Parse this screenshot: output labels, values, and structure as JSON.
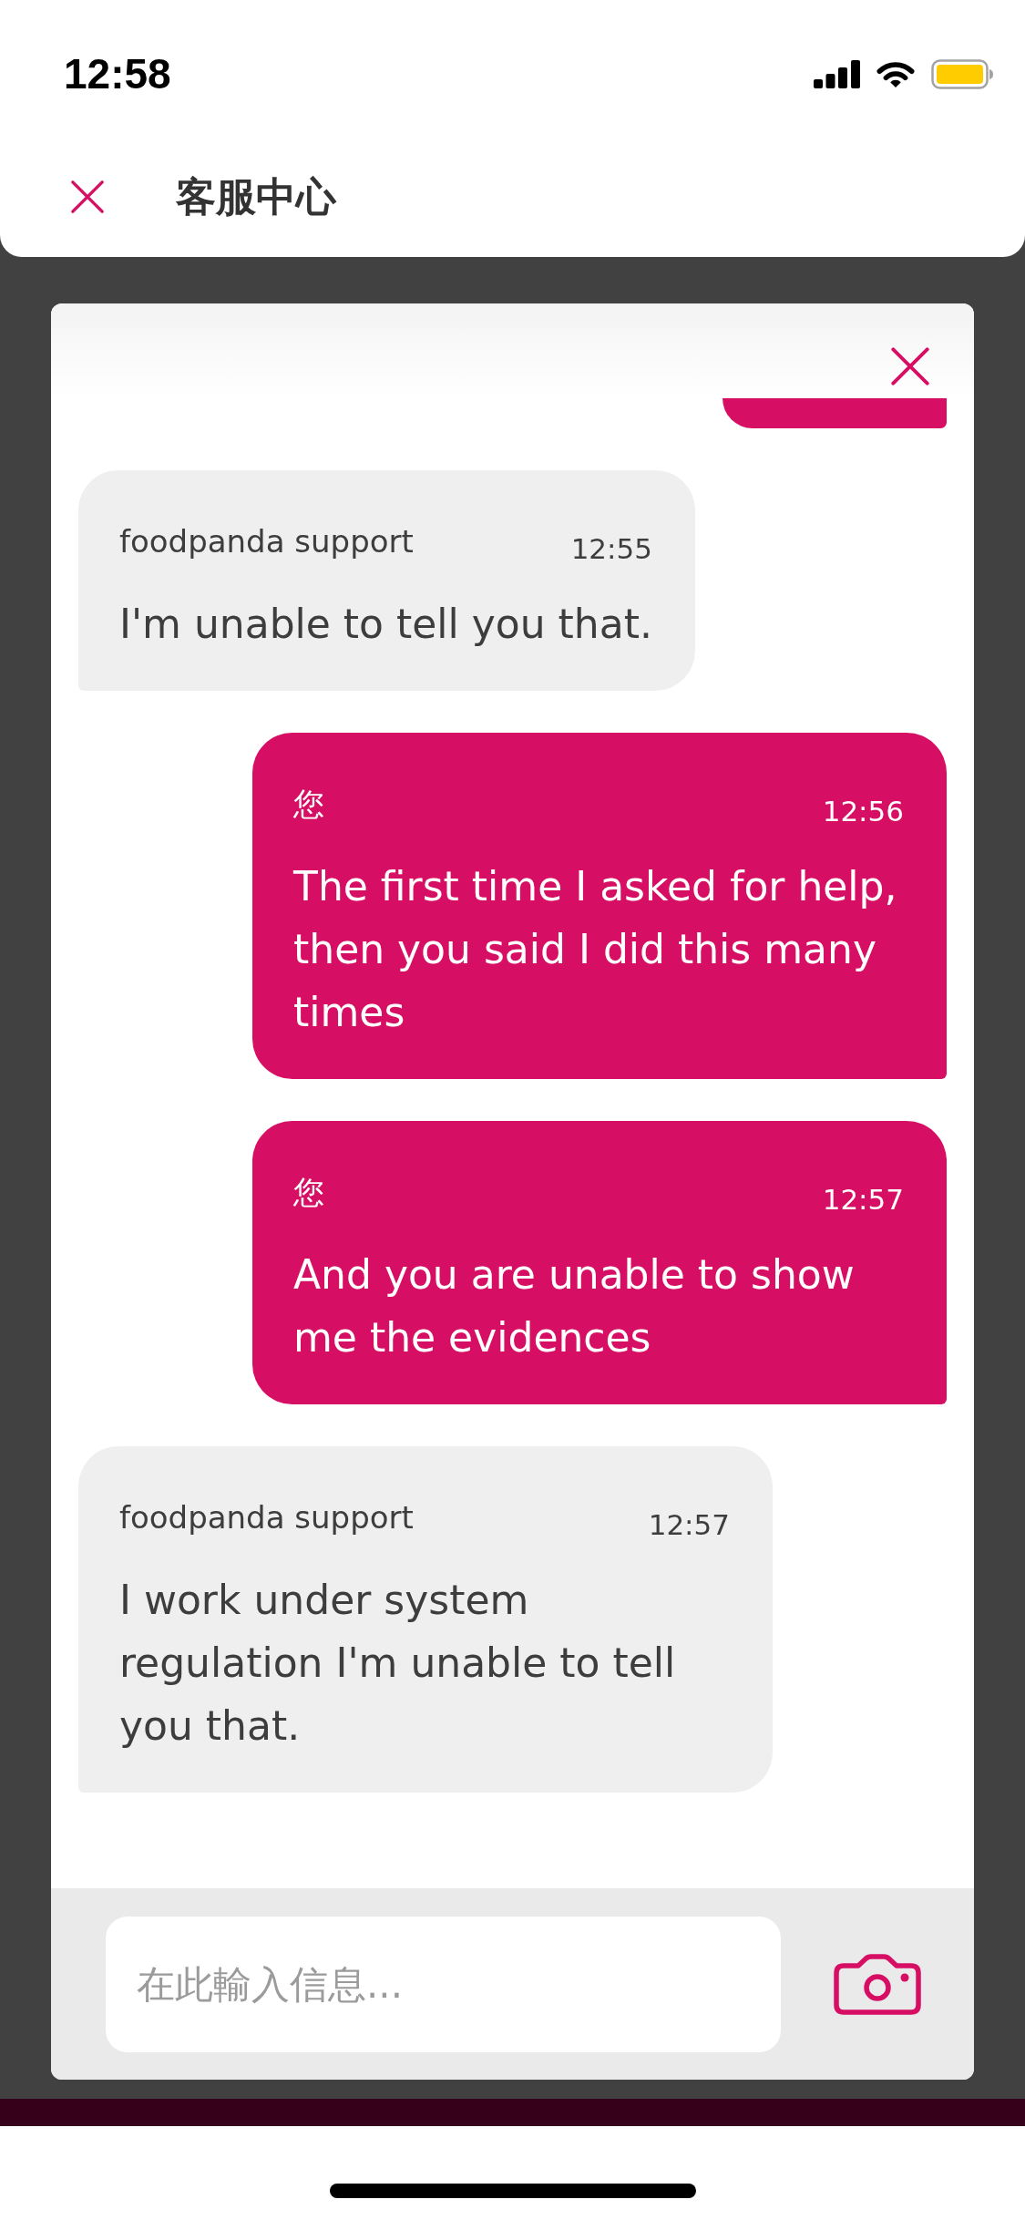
{
  "status_bar": {
    "time": "12:58"
  },
  "header": {
    "title": "客服中心"
  },
  "chat": {
    "messages": [
      {
        "kind": "outgoing"
      },
      {
        "kind": "incoming",
        "sender": "foodpanda support",
        "time": "12:55",
        "text": "I'm unable to tell you that."
      },
      {
        "kind": "outgoing",
        "sender": "您",
        "time": "12:56",
        "text": "The first time I asked for help, then you said I did this many times"
      },
      {
        "kind": "outgoing",
        "sender": "您",
        "time": "12:57",
        "text": "And you are unable to show me the evidences"
      },
      {
        "kind": "incoming",
        "sender": "foodpanda support",
        "time": "12:57",
        "text": "I work under system regulation I'm unable to tell you that."
      }
    ]
  },
  "composer": {
    "placeholder": "在此輸入信息..."
  }
}
